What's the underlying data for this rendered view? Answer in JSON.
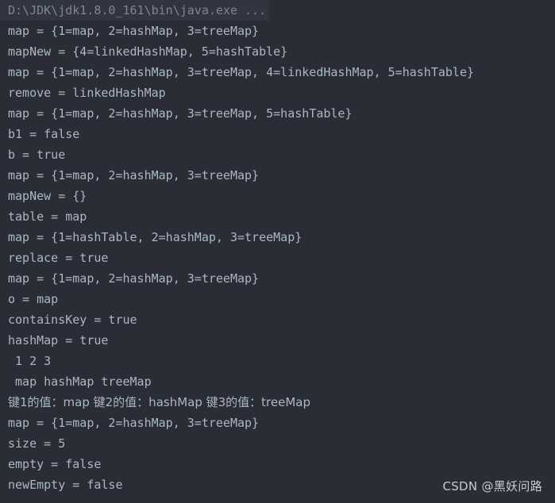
{
  "console": {
    "command_line": "D:\\JDK\\jdk1.8.0_161\\bin\\java.exe ...",
    "colors": {
      "background": "#2b2d36",
      "text": "#a9b7c6",
      "command_text": "#7a8799",
      "command_highlight": "#32353f",
      "watermark": "#c8cbd0"
    },
    "output_lines": [
      {
        "text": "map = {1=map, 2=hashMap, 3=treeMap}",
        "cjk": false
      },
      {
        "text": "mapNew = {4=linkedHashMap, 5=hashTable}",
        "cjk": false
      },
      {
        "text": "map = {1=map, 2=hashMap, 3=treeMap, 4=linkedHashMap, 5=hashTable}",
        "cjk": false
      },
      {
        "text": "remove = linkedHashMap",
        "cjk": false
      },
      {
        "text": "map = {1=map, 2=hashMap, 3=treeMap, 5=hashTable}",
        "cjk": false
      },
      {
        "text": "b1 = false",
        "cjk": false
      },
      {
        "text": "b = true",
        "cjk": false
      },
      {
        "text": "map = {1=map, 2=hashMap, 3=treeMap}",
        "cjk": false
      },
      {
        "text": "mapNew = {}",
        "cjk": false
      },
      {
        "text": "table = map",
        "cjk": false
      },
      {
        "text": "map = {1=hashTable, 2=hashMap, 3=treeMap}",
        "cjk": false
      },
      {
        "text": "replace = true",
        "cjk": false
      },
      {
        "text": "map = {1=map, 2=hashMap, 3=treeMap}",
        "cjk": false
      },
      {
        "text": "o = map",
        "cjk": false
      },
      {
        "text": "containsKey = true",
        "cjk": false
      },
      {
        "text": "hashMap = true",
        "cjk": false
      },
      {
        "text": " 1 2 3",
        "cjk": false
      },
      {
        "text": " map hashMap treeMap",
        "cjk": false
      },
      {
        "text": "键1的值：map 键2的值：hashMap 键3的值：treeMap",
        "cjk": true
      },
      {
        "text": "map = {1=map, 2=hashMap, 3=treeMap}",
        "cjk": false
      },
      {
        "text": "size = 5",
        "cjk": false
      },
      {
        "text": "empty = false",
        "cjk": false
      },
      {
        "text": "newEmpty = false",
        "cjk": false
      }
    ],
    "watermark": "CSDN @黑妖问路"
  }
}
